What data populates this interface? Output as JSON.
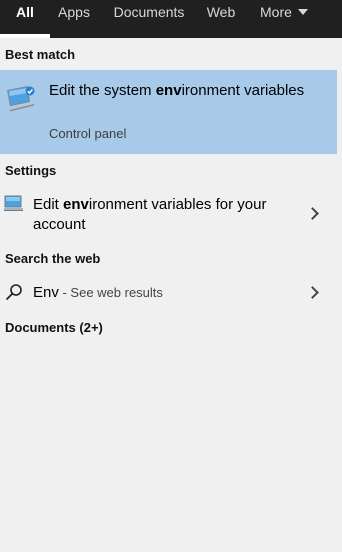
{
  "tabs": [
    {
      "label": "All",
      "active": true
    },
    {
      "label": "Apps"
    },
    {
      "label": "Documents"
    },
    {
      "label": "Web"
    },
    {
      "label": "More"
    }
  ],
  "best_match": {
    "header": "Best match",
    "title_prefix": "Edit the system ",
    "title_bold": "env",
    "title_suffix": "ironment variables",
    "subtitle": "Control panel",
    "icon": "system-properties-icon"
  },
  "settings": {
    "header": "Settings",
    "item": {
      "title_prefix": "Edit ",
      "title_bold": "env",
      "title_suffix": "ironment variables for your account",
      "icon": "monitor-settings-icon"
    }
  },
  "web": {
    "header": "Search the web",
    "query": "Env",
    "suffix": " - See web results",
    "icon": "search-icon"
  },
  "documents": {
    "header": "Documents (2+)"
  },
  "colors": {
    "topbar": "#202020",
    "panel": "#f0f0f0",
    "highlight": "#a8cae9"
  }
}
